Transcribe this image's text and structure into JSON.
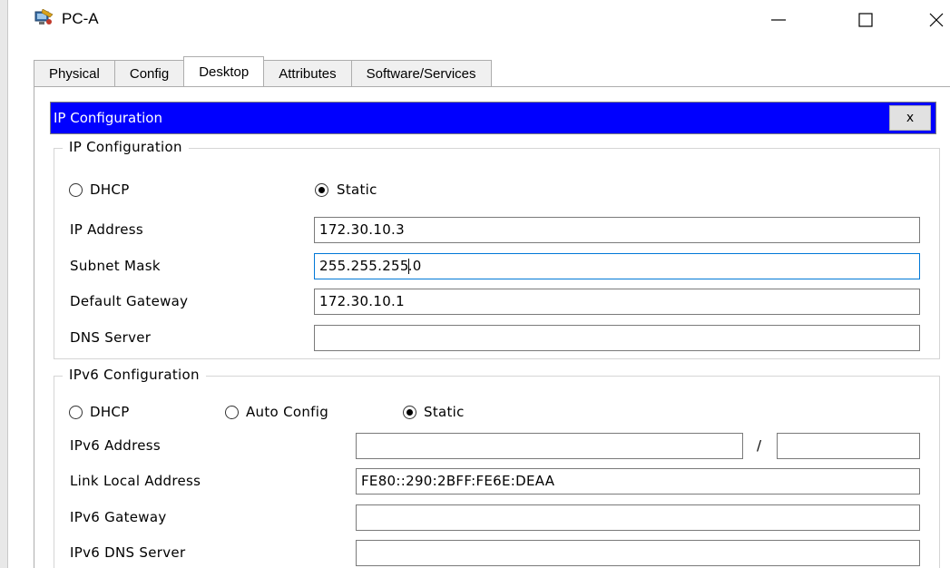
{
  "window": {
    "title": "PC-A",
    "minimize_label": "—",
    "maximize_label": "☐",
    "close_label": "✕"
  },
  "tabs": [
    {
      "label": "Physical",
      "active": false
    },
    {
      "label": "Config",
      "active": false
    },
    {
      "label": "Desktop",
      "active": true
    },
    {
      "label": "Attributes",
      "active": false
    },
    {
      "label": "Software/Services",
      "active": false
    }
  ],
  "ip_config": {
    "header_title": "IP Configuration",
    "close_label": "x",
    "header_color": "#0000ff",
    "ipv4": {
      "group_title": "IP Configuration",
      "mode_options": [
        "DHCP",
        "Static"
      ],
      "selected_mode": "Static",
      "fields": {
        "ip_address": {
          "label": "IP Address",
          "value": "172.30.10.3"
        },
        "subnet_mask": {
          "label": "Subnet Mask",
          "value_before_caret": "255.255.255",
          "value_after_caret": ".0"
        },
        "default_gateway": {
          "label": "Default Gateway",
          "value": "172.30.10.1"
        },
        "dns_server": {
          "label": "DNS Server",
          "value": ""
        }
      }
    },
    "ipv6": {
      "group_title": "IPv6 Configuration",
      "mode_options": [
        "DHCP",
        "Auto Config",
        "Static"
      ],
      "selected_mode": "Static",
      "fields": {
        "ipv6_address": {
          "label": "IPv6 Address",
          "value": "",
          "prefix_separator": "/",
          "prefix_value": ""
        },
        "link_local_address": {
          "label": "Link Local Address",
          "value": "FE80::290:2BFF:FE6E:DEAA"
        },
        "ipv6_gateway": {
          "label": "IPv6 Gateway",
          "value": ""
        },
        "ipv6_dns_server": {
          "label": "IPv6 DNS Server",
          "value": ""
        }
      }
    }
  },
  "icons": {
    "app": "packet-tracer-pc-icon",
    "minimize": "minimize-icon",
    "maximize": "maximize-icon",
    "close": "close-icon"
  }
}
